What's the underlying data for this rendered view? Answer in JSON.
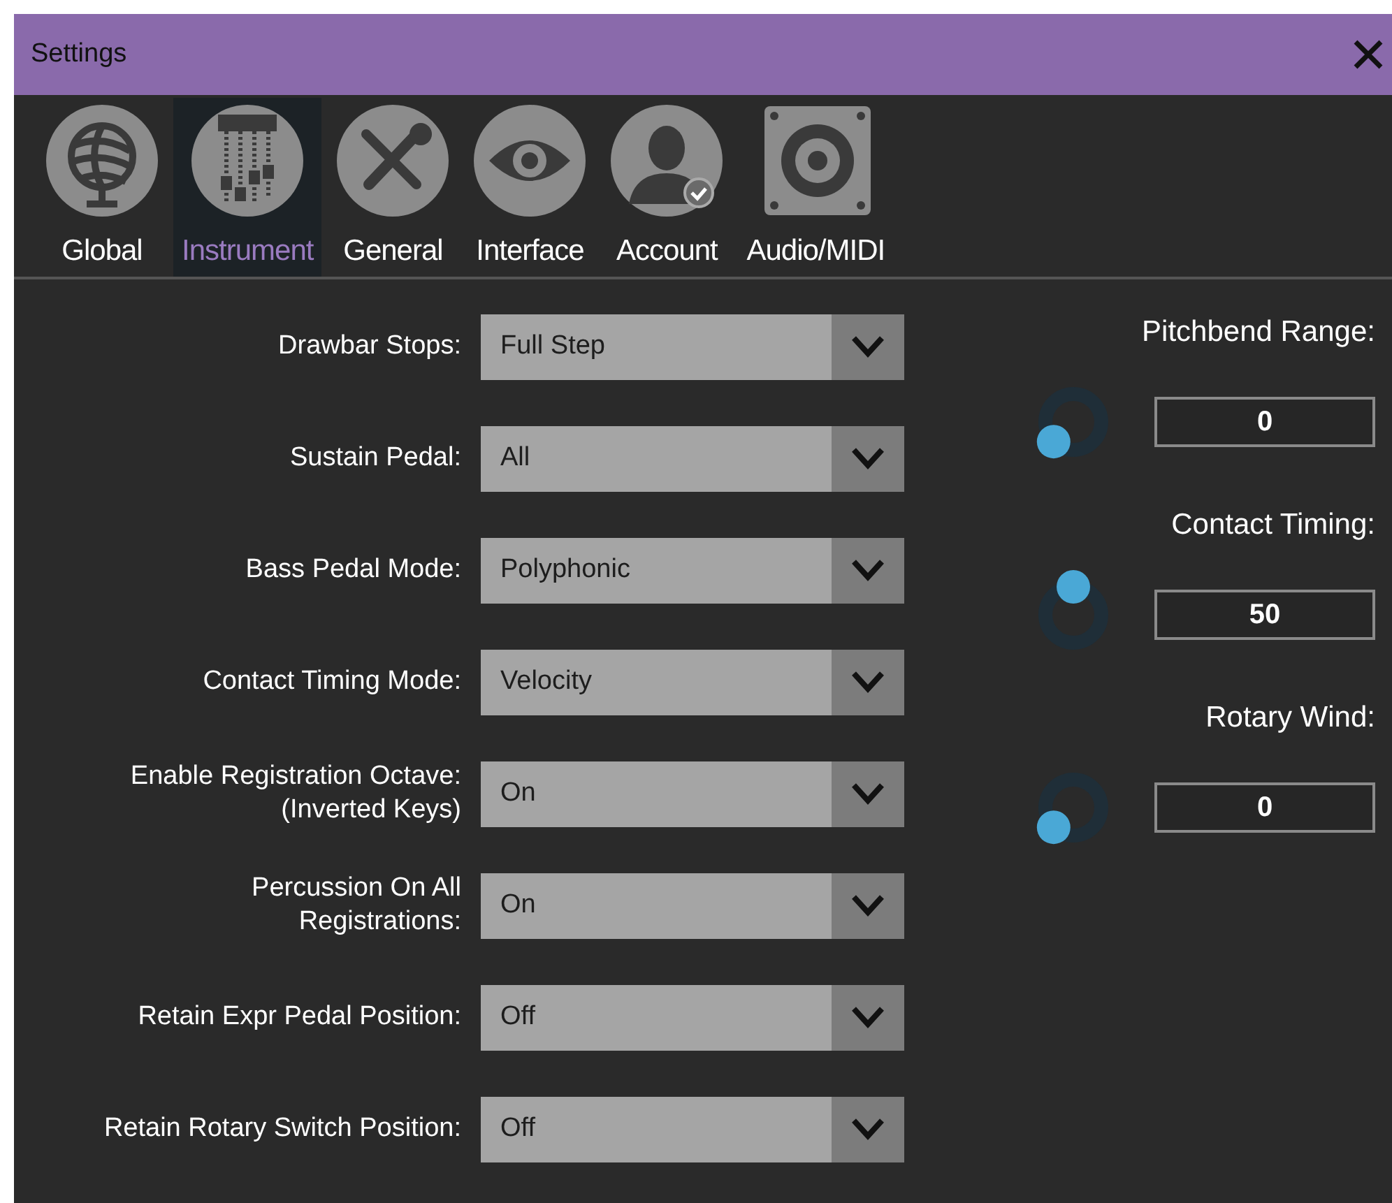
{
  "window": {
    "title": "Settings"
  },
  "tabs": [
    {
      "label": "Global",
      "selected": false
    },
    {
      "label": "Instrument",
      "selected": true
    },
    {
      "label": "General",
      "selected": false
    },
    {
      "label": "Interface",
      "selected": false
    },
    {
      "label": "Account",
      "selected": false
    },
    {
      "label": "Audio/MIDI",
      "selected": false
    }
  ],
  "options": [
    {
      "label": "Drawbar Stops:",
      "value": "Full Step"
    },
    {
      "label": "Sustain Pedal:",
      "value": "All"
    },
    {
      "label": "Bass Pedal Mode:",
      "value": "Polyphonic"
    },
    {
      "label": "Contact Timing Mode:",
      "value": "Velocity"
    },
    {
      "label": "Enable Registration Octave:\n(Inverted Keys)",
      "value": "On"
    },
    {
      "label": "Percussion On All\nRegistrations:",
      "value": "On"
    },
    {
      "label": "Retain Expr Pedal Position:",
      "value": "Off"
    },
    {
      "label": "Retain Rotary Switch Position:",
      "value": "Off"
    }
  ],
  "knobs": [
    {
      "label": "Pitchbend Range:",
      "value": "0"
    },
    {
      "label": "Contact Timing:",
      "value": "50"
    },
    {
      "label": "Rotary Wind:",
      "value": "0"
    }
  ]
}
